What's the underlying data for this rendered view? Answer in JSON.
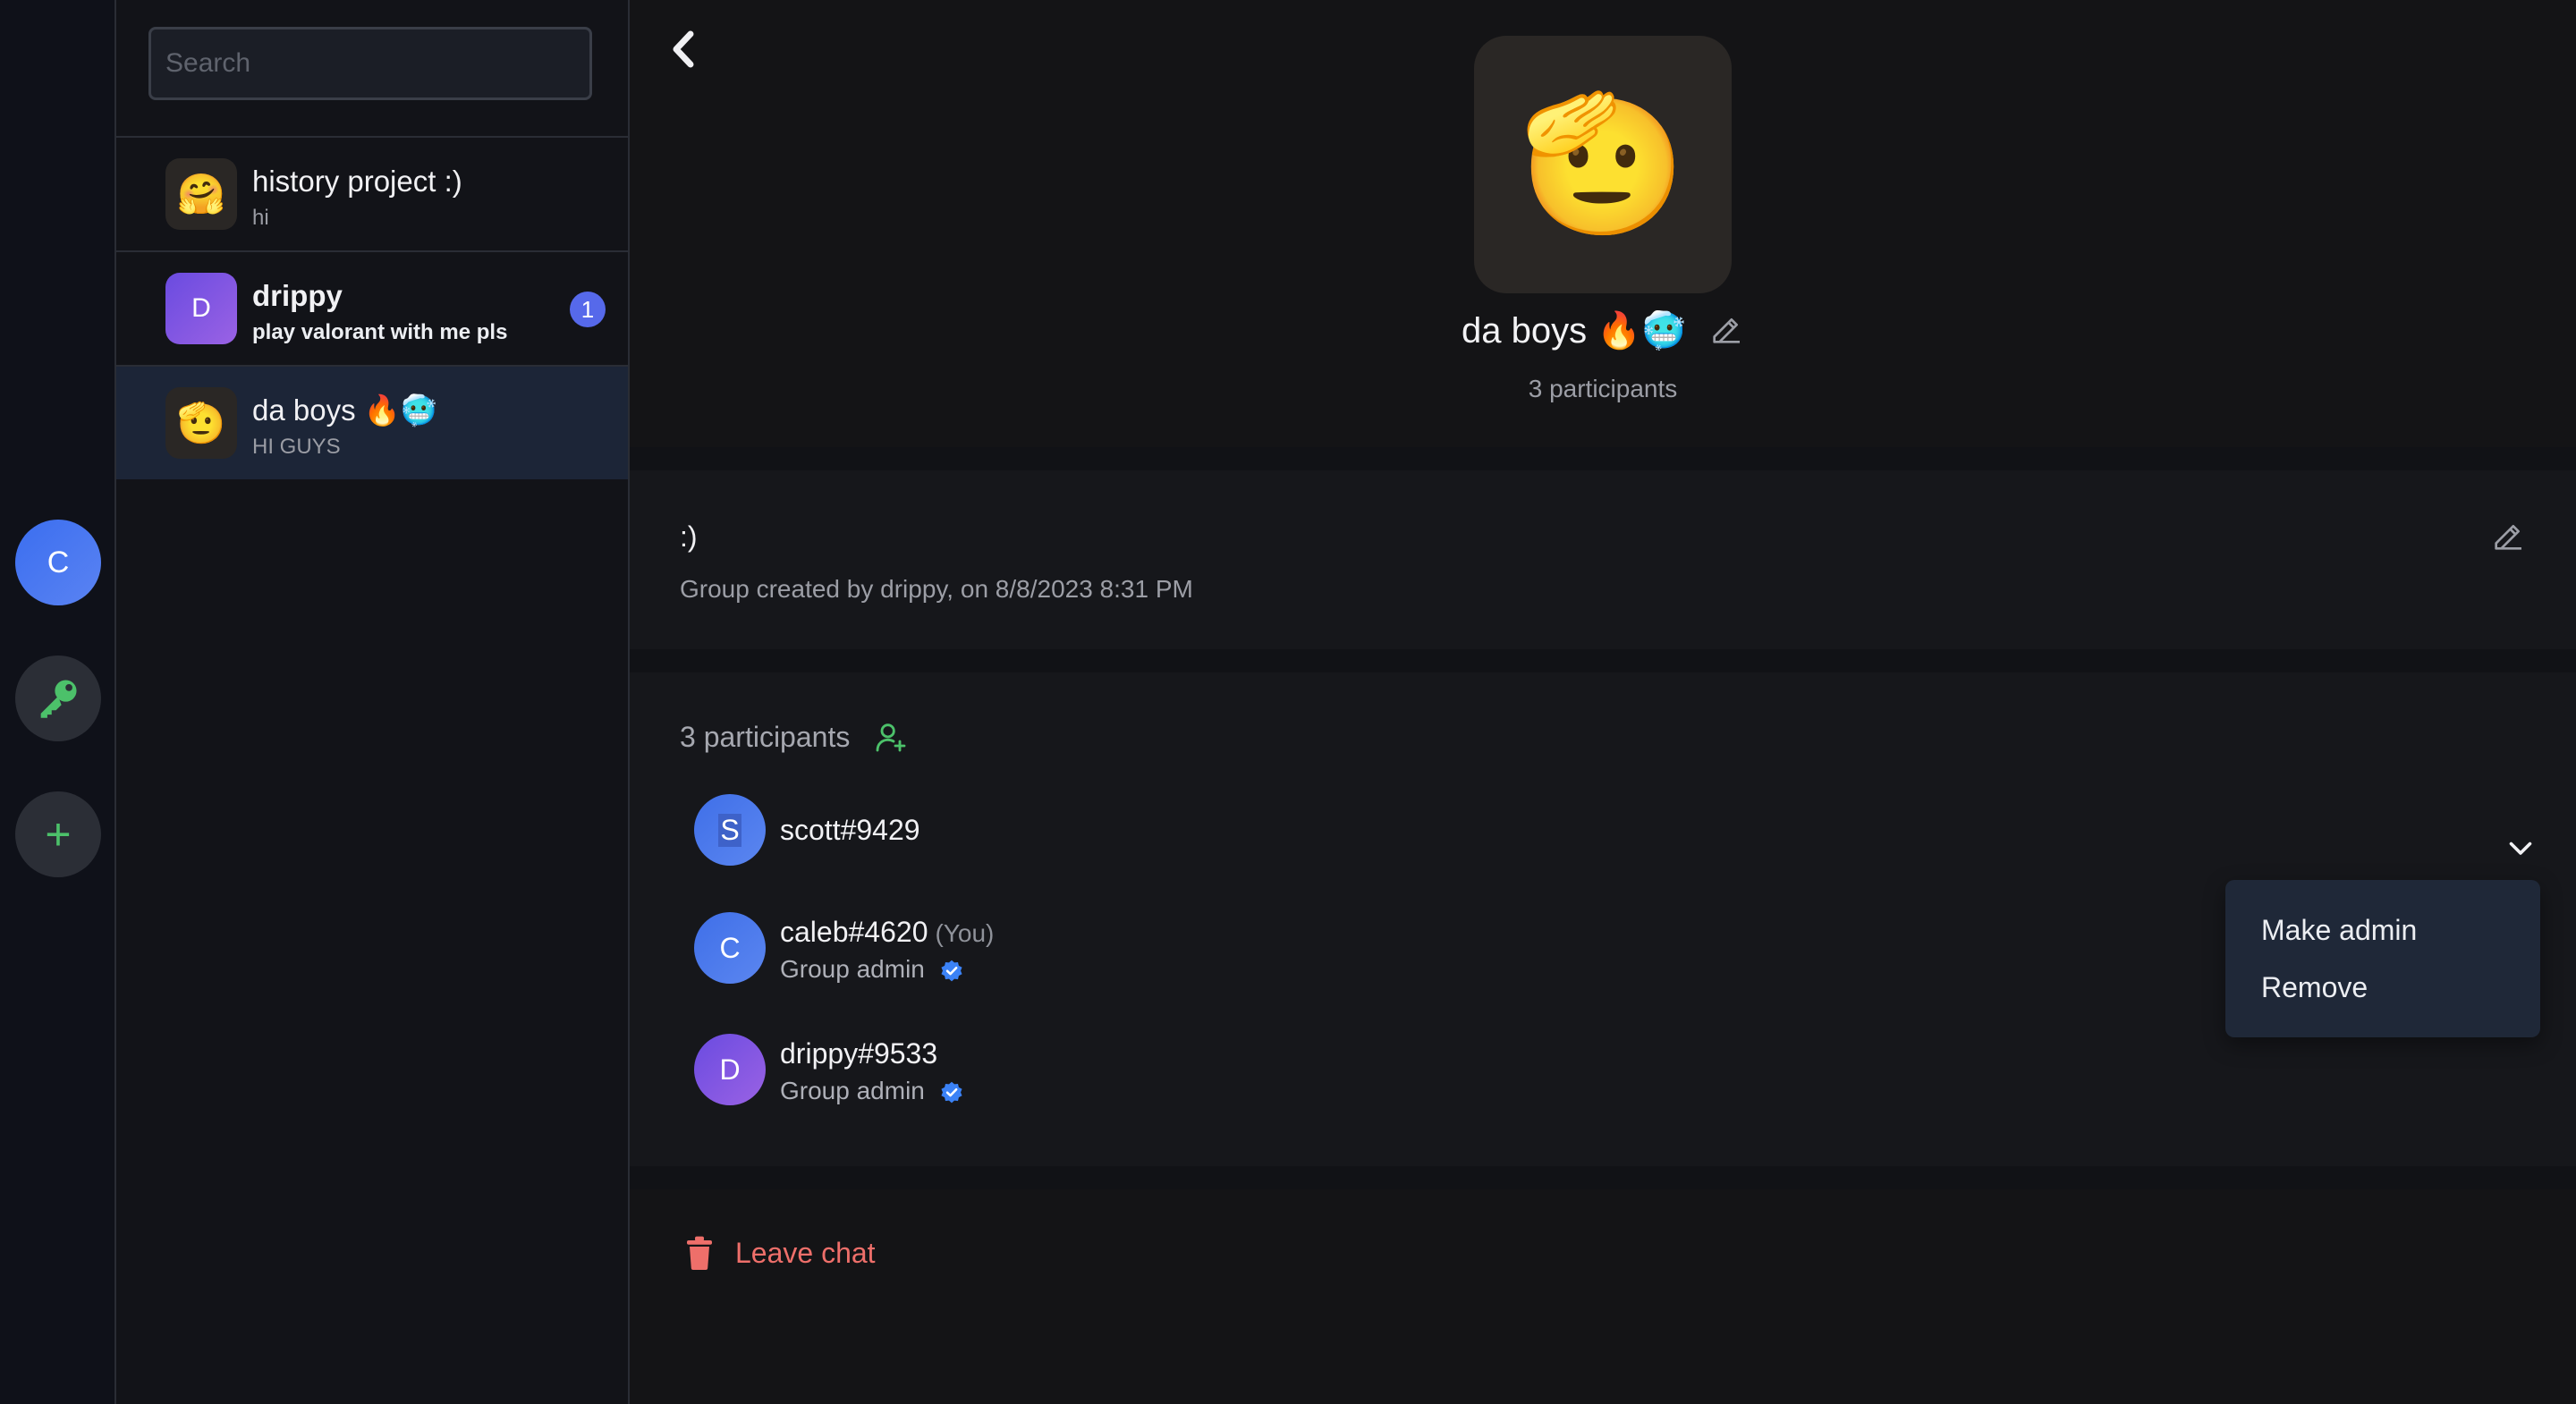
{
  "rail": {
    "user_initial": "C",
    "add_symbol": "+"
  },
  "search": {
    "placeholder": "Search",
    "value": ""
  },
  "chats": [
    {
      "title": "history project :)",
      "preview": "hi",
      "avatar_emoji": "🤗",
      "unread": null,
      "active": false
    },
    {
      "title": "drippy",
      "preview": "play valorant with me pls",
      "avatar_initial": "D",
      "unread": "1",
      "active": false
    },
    {
      "title": "da boys 🔥🥶",
      "preview": "HI GUYS",
      "avatar_emoji": "🫡",
      "unread": null,
      "active": true
    }
  ],
  "group": {
    "name": "da boys 🔥🥶",
    "participants_count": "3 participants",
    "description": ":)",
    "created_info": "Group created by drippy, on 8/8/2023 8:31 PM",
    "avatar_emoji": "🫡"
  },
  "participants": {
    "heading": "3 participants",
    "members": [
      {
        "initial_prefix": "",
        "initial": "S",
        "name": "scott#9429",
        "you": "",
        "role": ""
      },
      {
        "initial": "C",
        "name": "caleb#4620",
        "you": "(You)",
        "role": "Group admin"
      },
      {
        "initial": "D",
        "name": "drippy#9533",
        "you": "",
        "role": "Group admin"
      }
    ]
  },
  "context_menu": {
    "items": [
      "Make admin",
      "Remove"
    ]
  },
  "leave": {
    "label": "Leave chat"
  },
  "colors": {
    "accent": "#5669ea",
    "danger": "#ee6f6a",
    "success": "#4cc16a",
    "verified": "#3b82f6"
  },
  "icons": {
    "back": "chevron-left-icon",
    "edit": "pencil-icon",
    "add_participant": "user-plus-icon",
    "chevron": "chevron-down-icon",
    "verified": "verified-badge-icon",
    "trash": "trash-icon",
    "key": "key-icon",
    "add": "plus-icon"
  }
}
